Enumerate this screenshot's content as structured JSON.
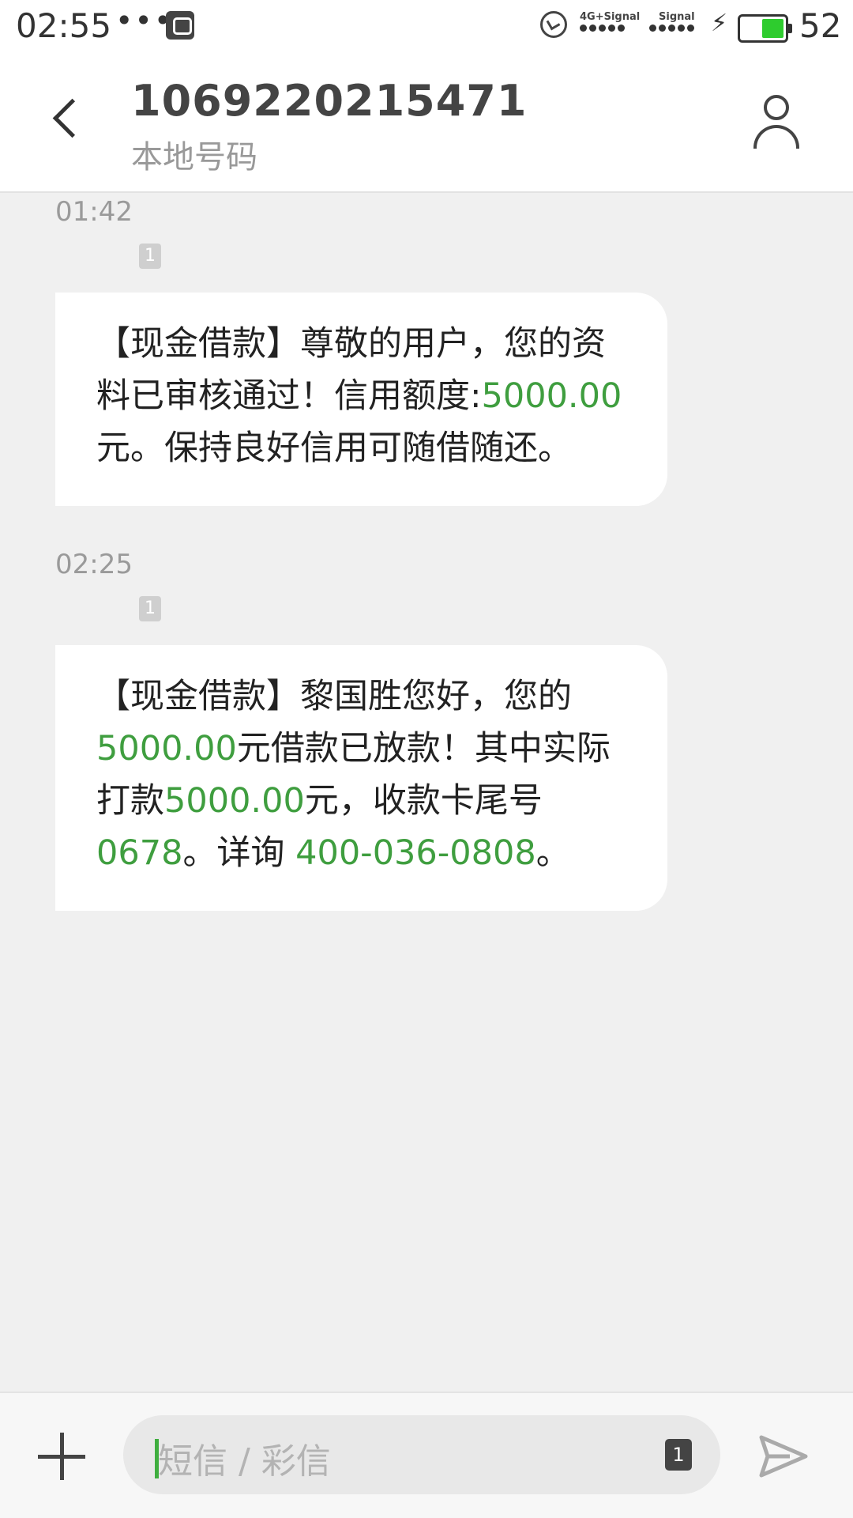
{
  "status_bar": {
    "time": "02:55",
    "more": "•••",
    "signal1_label": "4G+Signal",
    "signal2_label": "Signal",
    "battery": "52",
    "battery_color": "#2ecc2e"
  },
  "header": {
    "contact_number": "1069220215471",
    "contact_subtitle": "本地号码",
    "back_icon": "chevron-left-icon",
    "contact_icon": "person-icon"
  },
  "messages": [
    {
      "time": "01:42",
      "sim": "1",
      "segments": [
        {
          "text": "【现金借款】尊敬的用户，您的资料已审核通过！信用额度:",
          "hl": false
        },
        {
          "text": "5000.00",
          "hl": true
        },
        {
          "text": "元。保持良好信用可随借随还。",
          "hl": false
        }
      ]
    },
    {
      "time": "02:25",
      "sim": "1",
      "segments": [
        {
          "text": "【现金借款】黎国胜您好，您的",
          "hl": false
        },
        {
          "text": "5000.00",
          "hl": true
        },
        {
          "text": "元借款已放款！其中实际打款",
          "hl": false
        },
        {
          "text": "5000.00",
          "hl": true
        },
        {
          "text": "元，收款卡尾号",
          "hl": false
        },
        {
          "text": "0678",
          "hl": true
        },
        {
          "text": "。详询 ",
          "hl": false
        },
        {
          "text": "400-036-0808",
          "hl": true
        },
        {
          "text": "。",
          "hl": false
        }
      ]
    }
  ],
  "input": {
    "placeholder": "短信 / 彩信",
    "sim_select": "1"
  },
  "colors": {
    "highlight": "#3f9e3f",
    "background": "#f0f0f0",
    "bubble": "#ffffff"
  }
}
